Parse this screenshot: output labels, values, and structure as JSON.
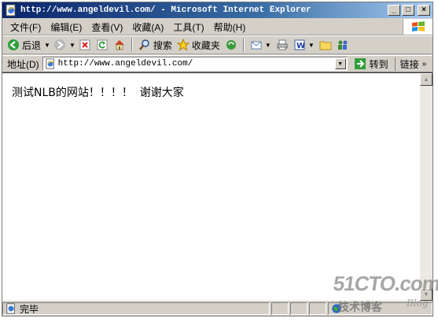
{
  "window": {
    "title": "http://www.angeldevil.com/ - Microsoft Internet Explorer",
    "minimize": "_",
    "maximize": "□",
    "close": "×"
  },
  "menu": {
    "items": [
      "文件(F)",
      "编辑(E)",
      "查看(V)",
      "收藏(A)",
      "工具(T)",
      "帮助(H)"
    ]
  },
  "toolbar": {
    "back_label": "后退",
    "search_label": "搜索",
    "favorites_label": "收藏夹"
  },
  "address": {
    "label": "地址(D)",
    "url": "http://www.angeldevil.com/",
    "go_label": "转到",
    "links_label": "链接"
  },
  "page": {
    "text": "测试NLB的网站！！！！  谢谢大家"
  },
  "status": {
    "text": "完毕"
  },
  "watermark": {
    "brand": "51CTO.com",
    "sub": "技术博客",
    "blog": "Blog"
  },
  "colors": {
    "titlebar_start": "#0a246a",
    "titlebar_end": "#a6caf0",
    "chrome": "#d4d0c8"
  }
}
